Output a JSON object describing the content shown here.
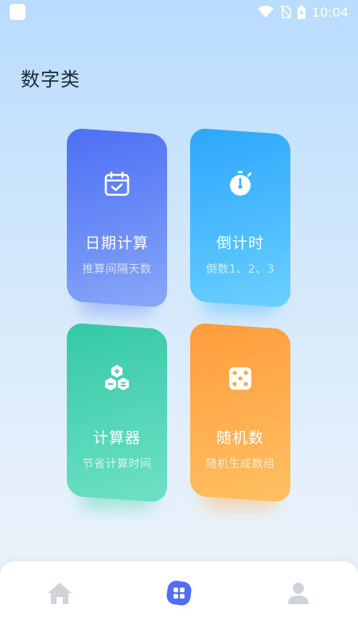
{
  "status_bar": {
    "time": "10:04"
  },
  "page": {
    "section_title": "数字类"
  },
  "cards": [
    {
      "title": "日期计算",
      "subtitle": "推算间隔天数",
      "icon": "calendar-check-icon"
    },
    {
      "title": "倒计时",
      "subtitle": "倒数1、2、3",
      "icon": "stopwatch-icon"
    },
    {
      "title": "计算器",
      "subtitle": "节省计算时间",
      "icon": "calculator-hex-icon"
    },
    {
      "title": "随机数",
      "subtitle": "随机生成数组",
      "icon": "dice-icon"
    }
  ],
  "bottom_nav": {
    "items": [
      {
        "icon": "home-icon",
        "active": false
      },
      {
        "icon": "apps-icon",
        "active": true
      },
      {
        "icon": "user-icon",
        "active": false
      }
    ],
    "colors": {
      "active": "#4f6df5",
      "inactive": "#cfd3da"
    }
  }
}
